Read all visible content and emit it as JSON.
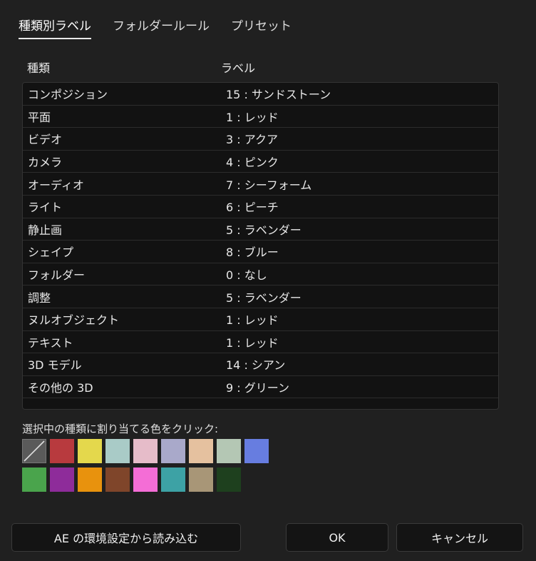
{
  "tabs": [
    {
      "label": "種類別ラベル",
      "active": true
    },
    {
      "label": "フォルダールール",
      "active": false
    },
    {
      "label": "プリセット",
      "active": false
    }
  ],
  "columns": {
    "type": "種類",
    "label": "ラベル"
  },
  "rows": [
    {
      "type": "コンポジション",
      "label": "15 : サンドストーン"
    },
    {
      "type": "平面",
      "label": "1 : レッド"
    },
    {
      "type": "ビデオ",
      "label": "3 : アクア"
    },
    {
      "type": "カメラ",
      "label": "4 : ピンク"
    },
    {
      "type": "オーディオ",
      "label": "7 : シーフォーム"
    },
    {
      "type": "ライト",
      "label": "6 : ピーチ"
    },
    {
      "type": "静止画",
      "label": "5 : ラベンダー"
    },
    {
      "type": "シェイプ",
      "label": "8 : ブルー"
    },
    {
      "type": "フォルダー",
      "label": "0 : なし"
    },
    {
      "type": "調整",
      "label": "5 : ラベンダー"
    },
    {
      "type": "ヌルオブジェクト",
      "label": "1 : レッド"
    },
    {
      "type": "テキスト",
      "label": "1 : レッド"
    },
    {
      "type": "3D モデル",
      "label": "14 : シアン"
    },
    {
      "type": "その他の 3D",
      "label": "9 : グリーン"
    }
  ],
  "swatch_prompt": "選択中の種類に割り当てる色をクリック:",
  "swatches_row1": [
    "none",
    "#b83a3e",
    "#e4d84c",
    "#a9cbc7",
    "#e6bcc9",
    "#a9a9ca",
    "#e5c19f",
    "#b4c7b4",
    "#677de0"
  ],
  "swatches_row2": [
    "#4aa44c",
    "#8e2c9a",
    "#e8920d",
    "#7f452a",
    "#f46dd6",
    "#3da2a5",
    "#a89677",
    "#1e401e"
  ],
  "buttons": {
    "import": "AE の環境設定から読み込む",
    "ok": "OK",
    "cancel": "キャンセル"
  }
}
